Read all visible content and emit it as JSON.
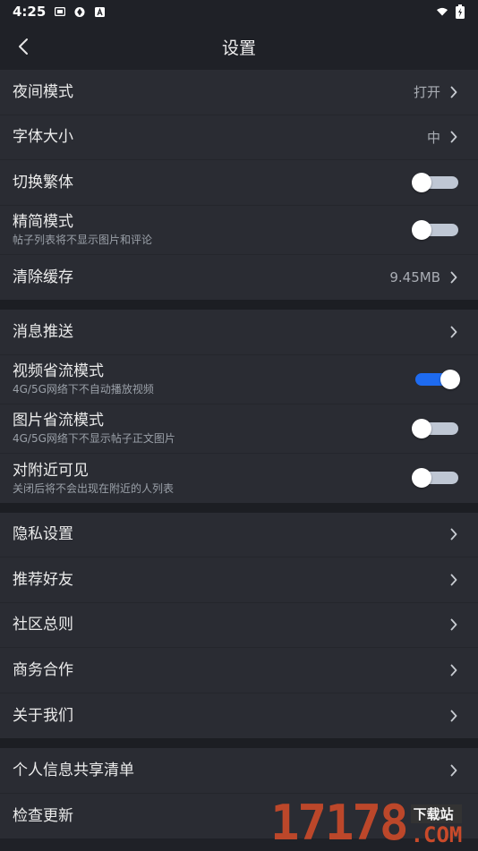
{
  "status_bar": {
    "time": "4:25",
    "icons": [
      "mail-icon",
      "sync-icon",
      "a-icon"
    ],
    "right_icons": [
      "wifi-icon",
      "battery-icon"
    ]
  },
  "header": {
    "title": "设置",
    "back_icon": "chevron-left-icon"
  },
  "groups": [
    {
      "rows": [
        {
          "label": "夜间模式",
          "value": "打开",
          "type": "link"
        },
        {
          "label": "字体大小",
          "value": "中",
          "type": "link"
        },
        {
          "label": "切换繁体",
          "type": "toggle",
          "on": false
        },
        {
          "label": "精简模式",
          "sub": "帖子列表将不显示图片和评论",
          "type": "toggle",
          "on": false
        },
        {
          "label": "清除缓存",
          "value": "9.45MB",
          "type": "link"
        }
      ]
    },
    {
      "rows": [
        {
          "label": "消息推送",
          "type": "link"
        },
        {
          "label": "视频省流模式",
          "sub": "4G/5G网络下不自动播放视频",
          "type": "toggle",
          "on": true
        },
        {
          "label": "图片省流模式",
          "sub": "4G/5G网络下不显示帖子正文图片",
          "type": "toggle",
          "on": false
        },
        {
          "label": "对附近可见",
          "sub": "关闭后将不会出现在附近的人列表",
          "type": "toggle",
          "on": false
        }
      ]
    },
    {
      "rows": [
        {
          "label": "隐私设置",
          "type": "link"
        },
        {
          "label": "推荐好友",
          "type": "link"
        },
        {
          "label": "社区总则",
          "type": "link"
        },
        {
          "label": "商务合作",
          "type": "link"
        },
        {
          "label": "关于我们",
          "type": "link"
        }
      ]
    },
    {
      "rows": [
        {
          "label": "个人信息共享清单",
          "type": "link"
        },
        {
          "label": "检查更新",
          "type": "link"
        }
      ]
    }
  ],
  "watermark": {
    "number": "17178",
    "cn": "下载站",
    "domain": ".COM"
  },
  "colors": {
    "background": "#1f2127",
    "row_bg": "#2a2c33",
    "toggle_on": "#1e6bf0",
    "toggle_off_track": "#bfc7d4"
  }
}
